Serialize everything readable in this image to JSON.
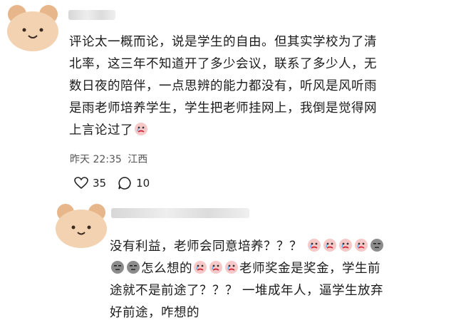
{
  "comment1": {
    "lines": [
      "评论太一概而论，说是学生的自由。但其实学校为了清",
      "北率，这三年不知道开了多少会议，联系了多少人，无",
      "数日夜的陪伴，一点思辨的能力都没有，听风是风听雨",
      "是雨老师培养学生，学生把老师挂网上，我倒是觉得网",
      "上言论过了"
    ],
    "trailing_emoji": "crying-face-emoji",
    "time": "昨天 22:35",
    "location": "江西",
    "likes": "35",
    "replies": "10"
  },
  "comment2": {
    "line1": "没有利益，老师会同意培养？？？",
    "line2_part1": "怎么想的",
    "line2_part2": "老师奖金是奖金，学生前",
    "line3": "途就不是前途了？？？ 一堆成年人，逼学生放弃",
    "line4": "好前途，咋想的",
    "line1_emojis": [
      "crying-face-emoji",
      "crying-face-emoji",
      "crying-face-emoji",
      "crying-face-emoji",
      "speechless-face-emoji"
    ],
    "line2_lead_emojis": [
      "speechless-face-emoji",
      "speechless-face-emoji"
    ],
    "line2_mid_emojis": [
      "crying-face-emoji",
      "crying-face-emoji",
      "crying-face-emoji"
    ]
  },
  "colors": {
    "bear_ear": "#e7b68b",
    "bear_face": "#f2d2b0",
    "meta_text": "#555555"
  }
}
